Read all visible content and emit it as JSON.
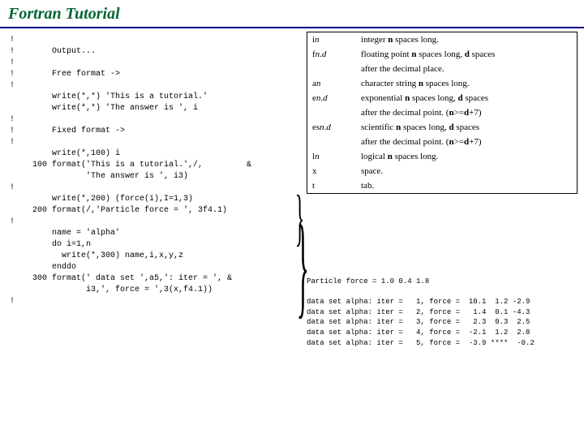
{
  "header": {
    "title": "Fortran Tutorial"
  },
  "code": {
    "lines": [
      {
        "c": "!",
        "l": "",
        "t": ""
      },
      {
        "c": "!",
        "l": "",
        "t": "Output..."
      },
      {
        "c": "!",
        "l": "",
        "t": ""
      },
      {
        "c": "!",
        "l": "",
        "t": "Free format ->"
      },
      {
        "c": "!",
        "l": "",
        "t": ""
      },
      {
        "c": "",
        "l": "",
        "t": "write(*,*) 'This is a tutorial.'"
      },
      {
        "c": "",
        "l": "",
        "t": "write(*,*) 'The answer is ', i"
      },
      {
        "c": "!",
        "l": "",
        "t": ""
      },
      {
        "c": "!",
        "l": "",
        "t": "Fixed format ->"
      },
      {
        "c": "!",
        "l": "",
        "t": ""
      },
      {
        "c": "",
        "l": "",
        "t": "write(*,100) i"
      },
      {
        "c": "",
        "l": "100",
        "t": "format('This is a tutorial.',/,         &"
      },
      {
        "c": "",
        "l": "",
        "t": "       'The answer is ', i3)"
      },
      {
        "c": "!",
        "l": "",
        "t": ""
      },
      {
        "c": "",
        "l": "",
        "t": "write(*,200) (force(i),I=1,3)"
      },
      {
        "c": "",
        "l": "200",
        "t": "format(/,'Particle force = ', 3f4.1)"
      },
      {
        "c": "!",
        "l": "",
        "t": ""
      },
      {
        "c": "",
        "l": "",
        "t": "name = 'alpha'"
      },
      {
        "c": "",
        "l": "",
        "t": "do i=1,n"
      },
      {
        "c": "",
        "l": "",
        "t": "  write(*,300) name,i,x,y,z"
      },
      {
        "c": "",
        "l": "",
        "t": "enddo"
      },
      {
        "c": "",
        "l": "300",
        "t": "format(' data set ',a5,': iter = ', &"
      },
      {
        "c": "",
        "l": "",
        "t": "       i3,', force = ',3(x,f4.1))"
      },
      {
        "c": "!",
        "l": "",
        "t": ""
      }
    ]
  },
  "formats": [
    {
      "spec": "in",
      "desc": "integer <b>n</b> spaces long."
    },
    {
      "spec": "fn.d",
      "desc": "floating point <b>n</b> spaces long, <b>d</b> spaces"
    },
    {
      "spec": "",
      "desc": "after the decimal place."
    },
    {
      "spec": "an",
      "desc": "character string <b>n</b> spaces long."
    },
    {
      "spec": "en.d",
      "desc": "exponential <b>n</b> spaces long, <b>d</b> spaces"
    },
    {
      "spec": "",
      "desc": "after the decimal point. (<b>n</b>>=<b>d</b>+7)"
    },
    {
      "spec": "esn.d",
      "desc": "scientific <b>n</b> spaces long, <b>d</b> spaces"
    },
    {
      "spec": "",
      "desc": "after the decimal point. (<b>n</b>>=<b>d</b>+7)"
    },
    {
      "spec": "ln",
      "desc": "logical <b>n</b> spaces long."
    },
    {
      "spec": "x",
      "desc": "space."
    },
    {
      "spec": "t",
      "desc": "tab."
    }
  ],
  "output": {
    "line1": "Particle force = 1.0 0.4 1.8",
    "rows": [
      "data set alpha: iter =   1, force =  10.1  1.2 -2.9",
      "data set alpha: iter =   2, force =   1.4  0.1 -4.3",
      "data set alpha: iter =   3, force =   2.3  0.3  2.5",
      "data set alpha: iter =   4, force =  -2.1  1.2  2.8",
      "data set alpha: iter =   5, force =  -3.9 ****  -0.2"
    ]
  }
}
